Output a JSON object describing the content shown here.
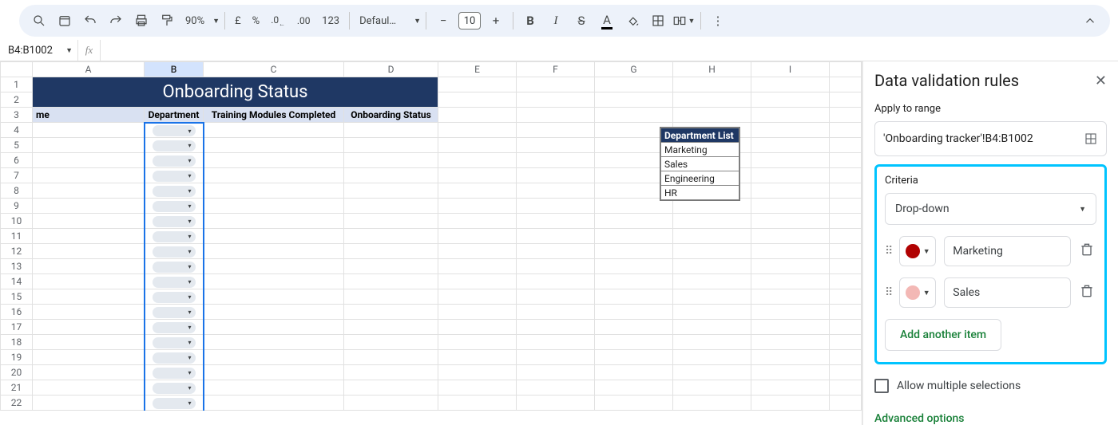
{
  "toolbar": {
    "zoom": "90%",
    "currency": "£",
    "percent": "%",
    "dec_dec": ".0",
    "dec_inc": ".00",
    "numfmt": "123",
    "font": "Defaul…",
    "fontsize": "10"
  },
  "namebox": "B4:B1002",
  "sheet": {
    "columns": [
      "A",
      "B",
      "C",
      "D",
      "E",
      "F",
      "G",
      "H",
      "I"
    ],
    "title_merged": "Onboarding Status",
    "headers": {
      "A": "me",
      "B": "Department",
      "C": "Training Modules Completed",
      "D": "Onboarding Status"
    },
    "row_numbers": [
      1,
      2,
      3,
      4,
      5,
      6,
      7,
      8,
      9,
      10,
      11,
      12,
      13,
      14,
      15,
      16,
      17,
      18,
      19,
      20,
      21,
      22
    ],
    "dept_list": {
      "title": "Department List",
      "rows": [
        "Marketing",
        "Sales",
        "Engineering",
        "HR"
      ]
    }
  },
  "panel": {
    "title": "Data validation rules",
    "apply_label": "Apply to range",
    "range": "'Onboarding tracker'!B4:B1002",
    "criteria_label": "Criteria",
    "criteria_type": "Drop-down",
    "options": [
      {
        "label": "Marketing",
        "color": "#b10202"
      },
      {
        "label": "Sales",
        "color": "#f3b8b5"
      }
    ],
    "add_item": "Add another item",
    "multi": "Allow multiple selections",
    "advanced": "Advanced options"
  }
}
